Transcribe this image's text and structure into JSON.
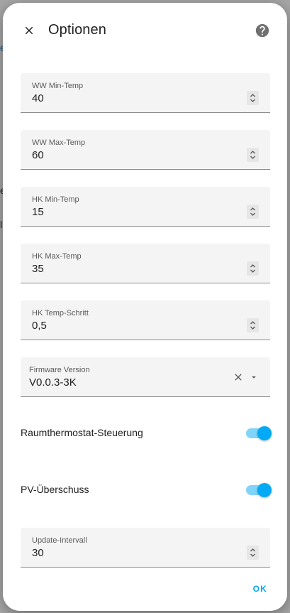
{
  "dialog": {
    "title": "Optionen",
    "icons": {
      "close": "close-icon",
      "help": "help-circle-icon"
    }
  },
  "fields": [
    {
      "label": "WW Min-Temp",
      "value": "40"
    },
    {
      "label": "WW Max-Temp",
      "value": "60"
    },
    {
      "label": "HK Min-Temp",
      "value": "15"
    },
    {
      "label": "HK Max-Temp",
      "value": "35"
    },
    {
      "label": "HK Temp-Schritt",
      "value": "0,5"
    }
  ],
  "firmware": {
    "label": "Firmware Version",
    "value": "V0.0.3-3K"
  },
  "toggles": [
    {
      "label": "Raumthermostat-Steuerung",
      "checked": true
    },
    {
      "label": "PV-Überschuss",
      "checked": true
    }
  ],
  "update_interval": {
    "label": "Update-Intervall",
    "value": "30"
  },
  "actions": {
    "ok_label": "OK"
  },
  "background": {
    "fragments": [
      "er",
      "e",
      "ll"
    ]
  },
  "colors": {
    "accent": "#03a9f4",
    "thumb": "#03a9f4",
    "track": "#03a9f4"
  }
}
